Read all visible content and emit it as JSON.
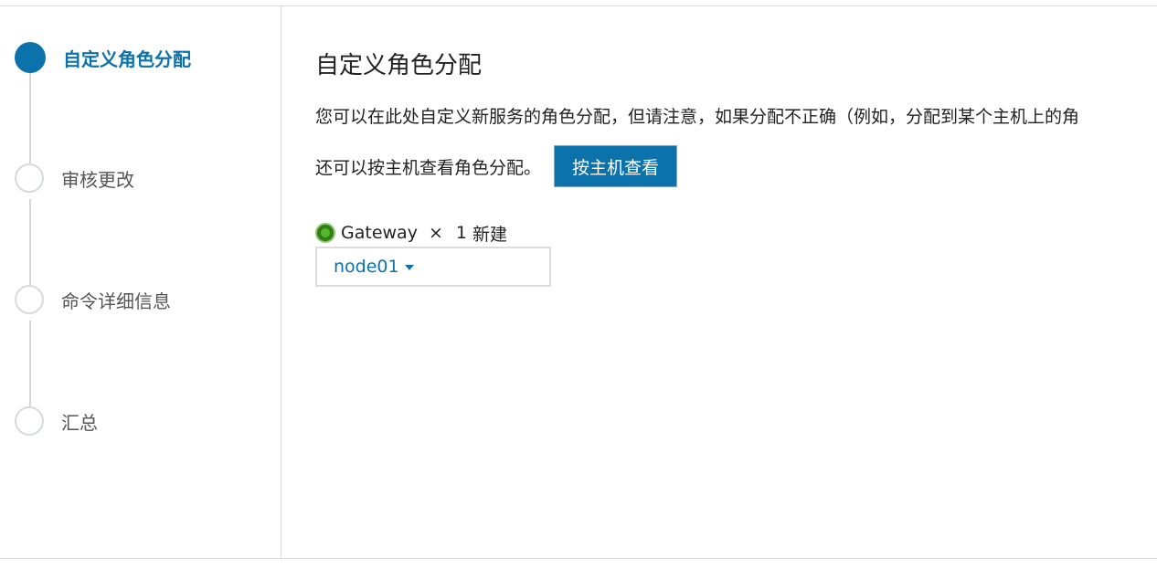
{
  "wizard": {
    "steps": [
      {
        "label": "自定义角色分配",
        "state": "active"
      },
      {
        "label": "审核更改",
        "state": "pending"
      },
      {
        "label": "命令详细信息",
        "state": "pending"
      },
      {
        "label": "汇总",
        "state": "pending"
      }
    ]
  },
  "main": {
    "title": "自定义角色分配",
    "description": "您可以在此处自定义新服务的角色分配，但请注意，如果分配不正确（例如，分配到某个主机上的角",
    "view_by_host_text": "还可以按主机查看角色分配。",
    "view_by_host_button": "按主机查看",
    "role": {
      "icon": "gateway-role-icon",
      "name": "Gateway",
      "times": "×",
      "count": "1",
      "new_label": "新建",
      "selected_host": "node01"
    }
  },
  "colors": {
    "accent": "#0b72ab",
    "role_icon": "#2f7d14"
  }
}
